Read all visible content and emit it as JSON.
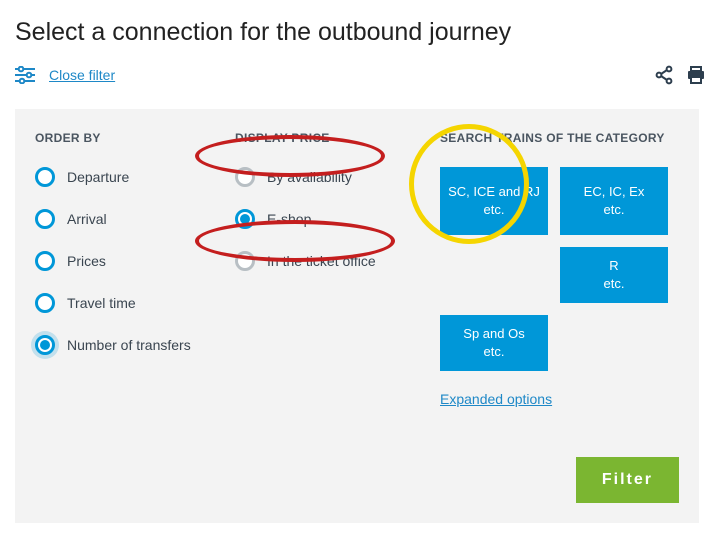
{
  "title": "Select a connection for the outbound journey",
  "close_filter": "Close filter",
  "order_by": {
    "heading": "ORDER BY",
    "options": {
      "departure": "Departure",
      "arrival": "Arrival",
      "prices": "Prices",
      "travel_time": "Travel time",
      "transfers": "Number of transfers"
    },
    "selected": "transfers"
  },
  "display_price": {
    "heading": "DISPLAY PRICE",
    "options": {
      "availability": "By availability",
      "eshop": "E-shop",
      "ticket_office": "In the ticket office"
    },
    "selected": "eshop"
  },
  "category": {
    "heading": "SEARCH TRAINS OF THE CATEGORY",
    "buttons": {
      "sc_ice": "SC, ICE and RJ\netc.",
      "ec_ic": "EC, IC, Ex\netc.",
      "r": "R\netc.",
      "sp_os": "Sp and Os\netc."
    },
    "expanded": "Expanded options"
  },
  "filter_button": "Filter"
}
